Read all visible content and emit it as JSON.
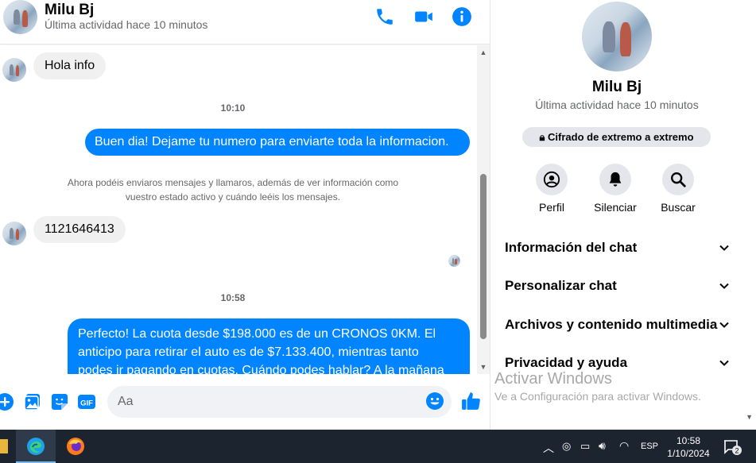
{
  "header": {
    "contact_name": "Milu Bj",
    "status": "Última actividad hace 10 minutos",
    "icons": [
      "phone-icon",
      "video-icon",
      "info-icon"
    ],
    "accent_color": "#0084ff"
  },
  "messages": {
    "msg1_text": "Hola info",
    "time1": "10:10",
    "msg2_text": "Buen dia! Dejame tu numero para enviarte toda la informacion.",
    "notice_line1": "Ahora podéis enviaros mensajes y llamaros, además de ver información como",
    "notice_line2": "vuestro estado activo y cuándo leéis los mensajes.",
    "msg3_text": "1121646413",
    "time2": "10:58",
    "msg4_line1": "Perfecto! La cuota desde $198.000 es de un CRONOS 0KM. El",
    "msg4_line2": "anticipo para retirar el auto es de $7.133.400, mientras tanto",
    "msg4_line3": "podes ir pagando en cuotas. Cuándo podes hablar? A la mañana"
  },
  "composer": {
    "placeholder": "Aa",
    "icons": [
      "plus-icon",
      "image-icon",
      "sticker-icon",
      "gif-icon",
      "emoji-icon",
      "thumbs-up-icon"
    ],
    "gif_label": "GIF"
  },
  "right_panel": {
    "name": "Milu Bj",
    "status": "Última actividad hace 10 minutos",
    "e2e_label": "Cifrado de extremo a extremo",
    "actions": [
      {
        "label": "Perfil",
        "icon": "profile-icon"
      },
      {
        "label": "Silenciar",
        "icon": "bell-icon"
      },
      {
        "label": "Buscar",
        "icon": "search-icon"
      }
    ],
    "sections": [
      {
        "label": "Información del chat"
      },
      {
        "label": "Personalizar chat"
      },
      {
        "label": "Archivos y contenido multimedia"
      },
      {
        "label": "Privacidad y ayuda"
      }
    ],
    "watermark_title": "Activar Windows",
    "watermark_sub": "Ve a Configuración para activar Windows."
  },
  "taskbar": {
    "apps": [
      "edge-icon",
      "firefox-icon"
    ],
    "language": "ESP",
    "time": "10:58",
    "date": "1/10/2024",
    "notification_count": "2"
  }
}
